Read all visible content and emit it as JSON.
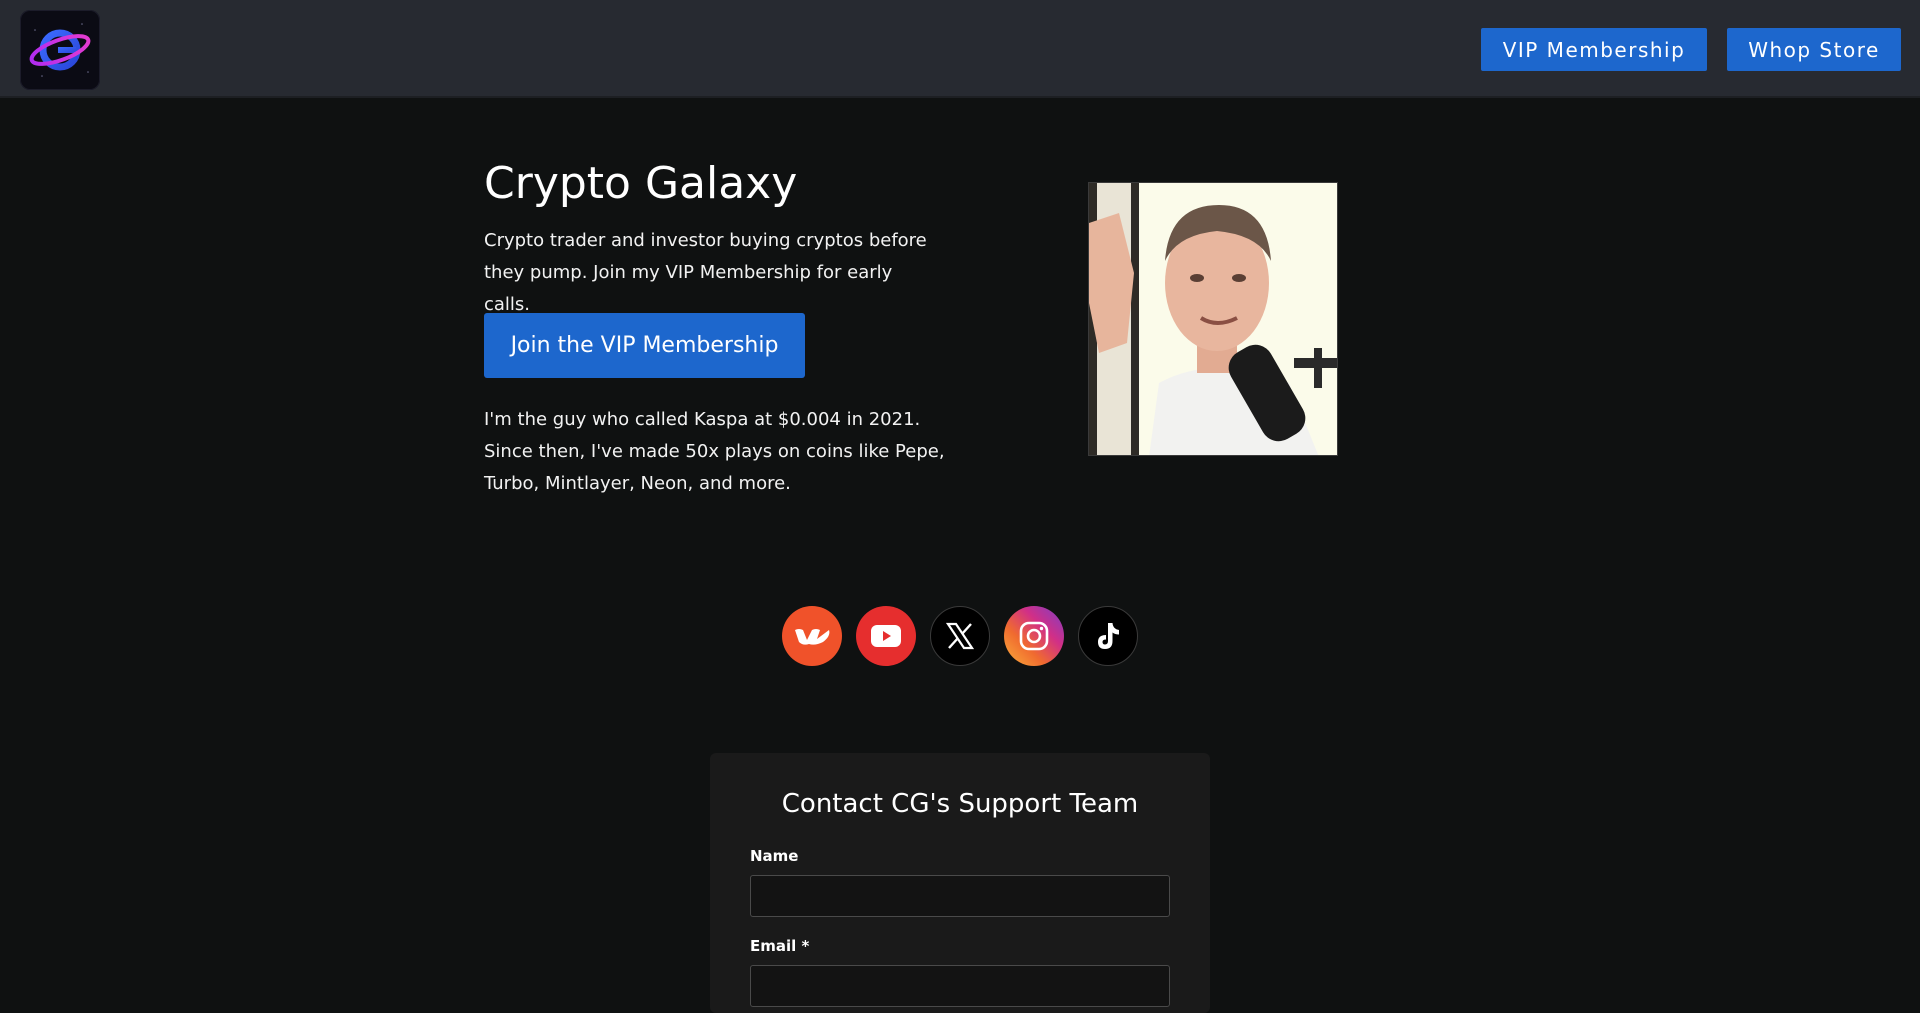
{
  "header": {
    "logo_icon": "planet-g-logo",
    "nav": {
      "vip_label": "VIP Membership",
      "store_label": "Whop Store"
    }
  },
  "hero": {
    "title": "Crypto Galaxy",
    "subtitle": "Crypto trader and investor buying cryptos before they pump. Join my VIP Membership for early calls.",
    "cta_label": "Join the VIP Membership",
    "story": "I'm the guy who called Kaspa at $0.004 in 2021. Since then, I've made 50x plays on coins like Pepe, Turbo, Mintlayer, Neon, and more."
  },
  "social": [
    {
      "icon": "whop-icon",
      "color": "#f0522a"
    },
    {
      "icon": "youtube-icon",
      "color": "#e62e2e"
    },
    {
      "icon": "x-icon",
      "color": "#000000"
    },
    {
      "icon": "instagram-icon",
      "color": "#d12f87"
    },
    {
      "icon": "tiktok-icon",
      "color": "#000000"
    }
  ],
  "contact": {
    "title": "Contact CG's Support Team",
    "name_label": "Name",
    "name_value": "",
    "email_label": "Email *",
    "email_value": ""
  },
  "colors": {
    "background": "#0f1111",
    "header": "#272a31",
    "accent": "#1d67cd",
    "card": "#1a1a1a"
  }
}
